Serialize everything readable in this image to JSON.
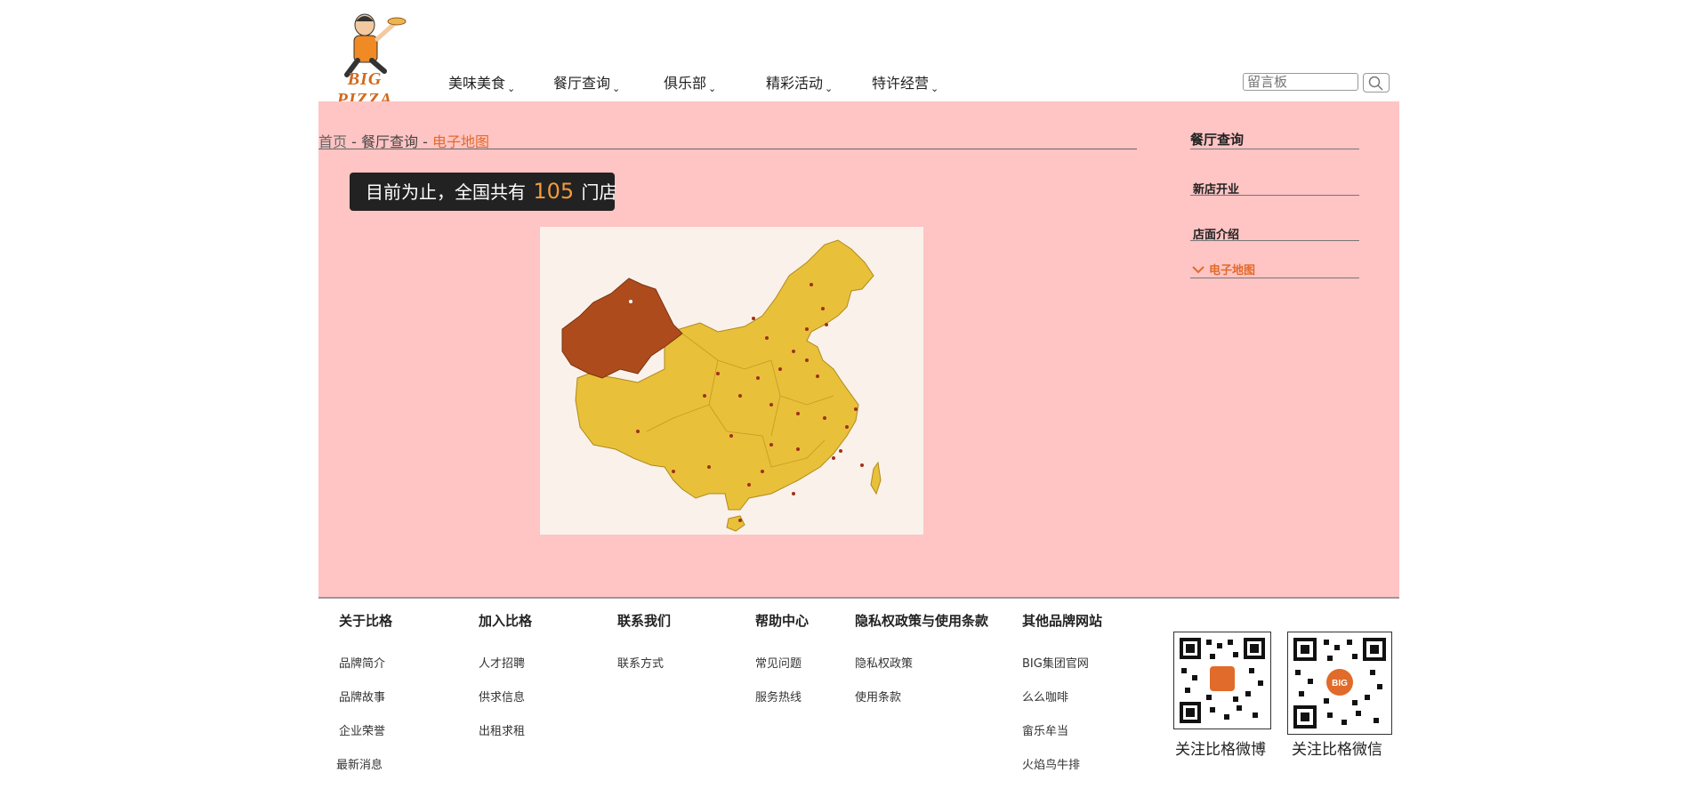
{
  "header": {
    "logo_text": "BIG PIZZA",
    "nav": [
      {
        "label": "美味美食"
      },
      {
        "label": "餐厅查询"
      },
      {
        "label": "俱乐部"
      },
      {
        "label": "精彩活动"
      },
      {
        "label": "特许经营"
      }
    ],
    "search_placeholder": "留言板",
    "icons": {
      "search": "search-icon",
      "chevron": "chevron-down-icon"
    }
  },
  "breadcrumb": {
    "home": "首页",
    "sep": " - ",
    "section": "餐厅查询",
    "current": "电子地图"
  },
  "store_count": {
    "prefix": "目前为止，全国共有",
    "count": "105",
    "suffix": "门店"
  },
  "map": {
    "highlight_region": "新疆",
    "highlight_city": "乌鲁木齐"
  },
  "sidebar": {
    "title": "餐厅查询",
    "items": [
      {
        "label": "新店开业"
      },
      {
        "label": "店面介绍"
      },
      {
        "label": "电子地图"
      }
    ]
  },
  "footer": {
    "columns": [
      {
        "title": "关于比格",
        "links": [
          "品牌简介",
          "品牌故事",
          "企业荣誉",
          "最新消息"
        ]
      },
      {
        "title": "加入比格",
        "links": [
          "人才招聘",
          "供求信息",
          "出租求租"
        ]
      },
      {
        "title": "联系我们",
        "links": [
          "联系方式"
        ]
      },
      {
        "title": "帮助中心",
        "links": [
          "常见问题",
          "服务热线"
        ]
      },
      {
        "title": "隐私权政策与使用条款",
        "links": [
          "隐私权政策",
          "使用条款"
        ]
      },
      {
        "title": "其他品牌网站",
        "links": [
          "BIG集团官网",
          "么么咖啡",
          "畲乐牟当",
          "火焰鸟牛排"
        ]
      }
    ],
    "qr": [
      {
        "label": "关注比格微博"
      },
      {
        "label": "关注比格微信",
        "badge": "BIG"
      }
    ]
  },
  "colors": {
    "accent": "#e06b2a",
    "main_bg": "#ffc4c4",
    "map_fill": "#e8c03a",
    "map_highlight": "#ae4b1c"
  }
}
